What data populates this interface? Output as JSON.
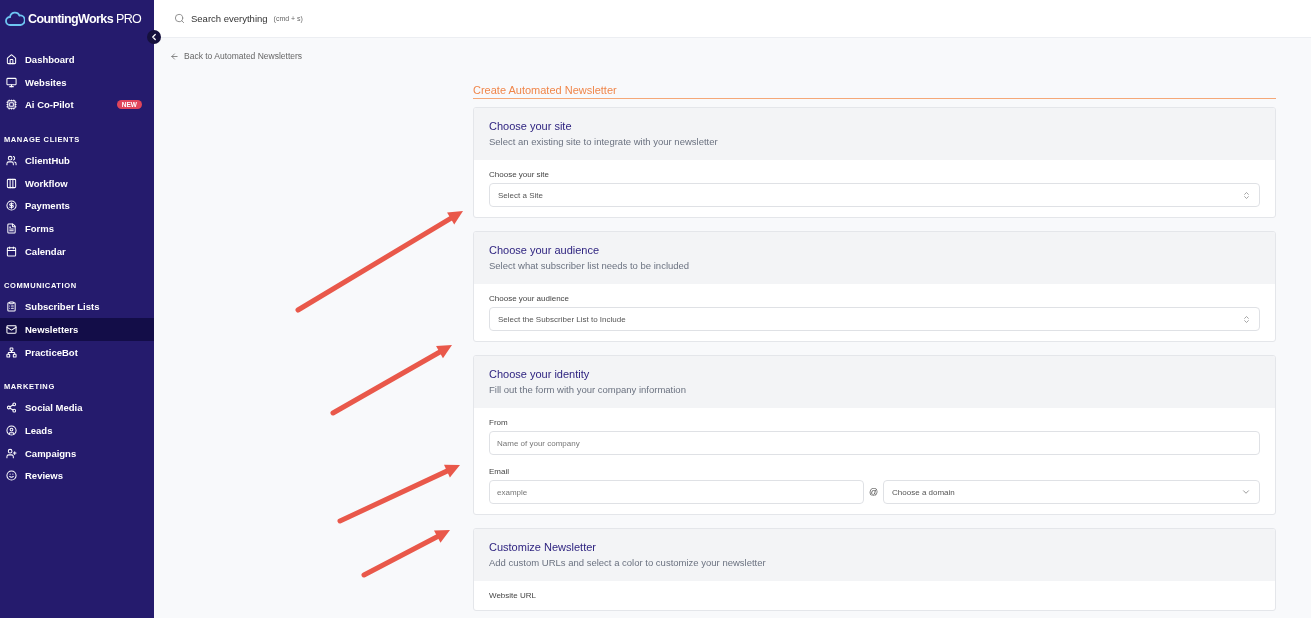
{
  "sidebar": {
    "brand": "CountingWorks",
    "brand_suffix": "PRO",
    "groups": [
      {
        "items": [
          {
            "label": "Dashboard",
            "selected": false
          },
          {
            "label": "Websites",
            "selected": false
          },
          {
            "label": "Ai Co-Pilot",
            "selected": false,
            "badge": "NEW"
          }
        ]
      },
      {
        "heading": "MANAGE CLIENTS",
        "items": [
          {
            "label": "ClientHub",
            "selected": false
          },
          {
            "label": "Workflow",
            "selected": false
          },
          {
            "label": "Payments",
            "selected": false
          },
          {
            "label": "Forms",
            "selected": false
          },
          {
            "label": "Calendar",
            "selected": false
          }
        ]
      },
      {
        "heading": "COMMUNICATION",
        "items": [
          {
            "label": "Subscriber Lists",
            "selected": false
          },
          {
            "label": "Newsletters",
            "selected": true
          },
          {
            "label": "PracticeBot",
            "selected": false
          }
        ]
      },
      {
        "heading": "MARKETING",
        "items": [
          {
            "label": "Social Media",
            "selected": false
          },
          {
            "label": "Leads",
            "selected": false
          },
          {
            "label": "Campaigns",
            "selected": false
          },
          {
            "label": "Reviews",
            "selected": false
          }
        ]
      }
    ]
  },
  "search": {
    "placeholder": "Search everything",
    "shortcut": "(cmd + s)"
  },
  "back_link": "Back to Automated Newsletters",
  "page_title": "Create Automated Newsletter",
  "cards": [
    {
      "title": "Choose your site",
      "subtitle": "Select an existing site to integrate with your newsletter",
      "fields": [
        {
          "kind": "select",
          "label": "Choose your site",
          "placeholder": "Select a Site"
        }
      ]
    },
    {
      "title": "Choose your audience",
      "subtitle": "Select what subscriber list needs to be included",
      "fields": [
        {
          "kind": "select",
          "label": "Choose your audience",
          "placeholder": "Select the Subscriber List to Include"
        }
      ]
    },
    {
      "title": "Choose your identity",
      "subtitle": "Fill out the form with your company information",
      "fields": [
        {
          "kind": "text",
          "label": "From",
          "placeholder": "Name of your company"
        },
        {
          "kind": "email",
          "label": "Email",
          "placeholder": "example",
          "separator": "@",
          "domain_placeholder": "Choose a domain"
        }
      ]
    },
    {
      "title": "Customize Newsletter",
      "subtitle": "Add custom URLs and select a color to customize your newsletter",
      "fields": [
        {
          "kind": "label",
          "label": "Website URL"
        }
      ]
    }
  ]
}
